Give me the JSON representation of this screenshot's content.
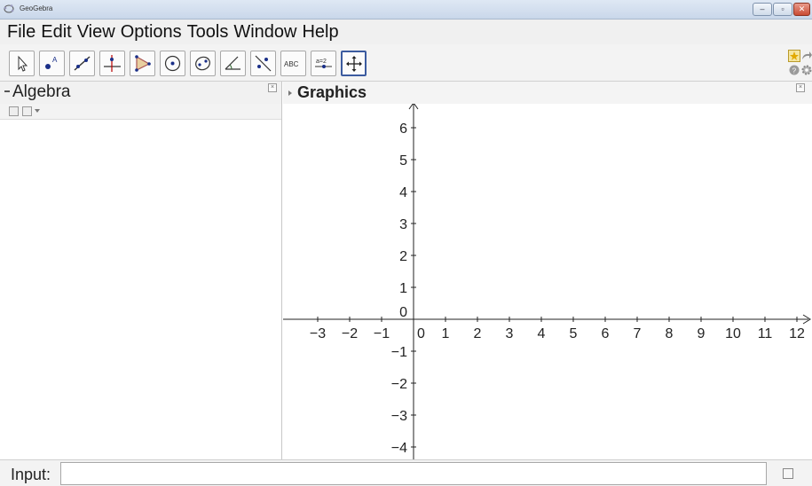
{
  "window": {
    "title": "GeoGebra",
    "controls": {
      "minimize": "–",
      "maximize": "▫",
      "close": "✕"
    }
  },
  "menu": {
    "items": [
      "File",
      "Edit",
      "View",
      "Options",
      "Tools",
      "Window",
      "Help"
    ]
  },
  "toolbar": {
    "tools": [
      {
        "icon": "move-pointer-icon"
      },
      {
        "icon": "new-point-icon"
      },
      {
        "icon": "line-through-two-points-icon"
      },
      {
        "icon": "perpendicular-line-icon"
      },
      {
        "icon": "polygon-icon"
      },
      {
        "icon": "circle-with-center-icon"
      },
      {
        "icon": "ellipse-icon"
      },
      {
        "icon": "angle-icon"
      },
      {
        "icon": "reflect-about-line-icon"
      },
      {
        "icon": "insert-text-icon",
        "label": "ABC"
      },
      {
        "icon": "slider-icon",
        "label": "a=2"
      },
      {
        "icon": "move-graphics-view-icon"
      }
    ]
  },
  "algebra": {
    "title": "Algebra"
  },
  "graphics": {
    "title": "Graphics",
    "x_ticks": [
      "-3",
      "-2",
      "-1",
      "0",
      "1",
      "2",
      "3",
      "4",
      "5",
      "6",
      "7",
      "8",
      "9",
      "10",
      "11",
      "12"
    ],
    "y_ticks": [
      "6",
      "5",
      "4",
      "3",
      "2",
      "1",
      "-1",
      "-2",
      "-3",
      "-4"
    ]
  },
  "input": {
    "label": "Input:",
    "value": ""
  },
  "colors": {
    "active_tool_border": "#3b5b9f",
    "title_bar": "#c9d7ea",
    "close_button": "#c94a33"
  }
}
